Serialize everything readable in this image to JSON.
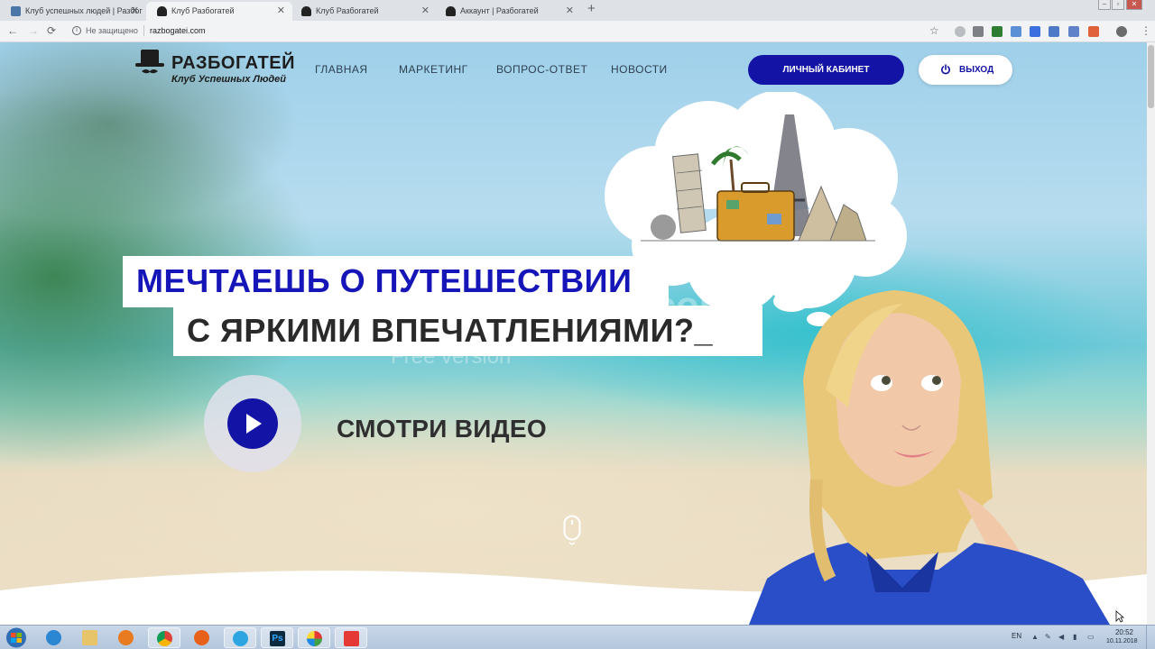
{
  "browser": {
    "tabs": [
      {
        "title": "Клуб успешных людей | Разбог",
        "active": false,
        "favicon_color": "#4a76a8"
      },
      {
        "title": "Клуб Разбогатей",
        "active": true,
        "favicon_color": "#222222"
      },
      {
        "title": "Клуб Разбогатей",
        "active": false,
        "favicon_color": "#222222"
      },
      {
        "title": "Аккаунт | Разбогатей",
        "active": false,
        "favicon_color": "#222222"
      }
    ],
    "new_tab": "+",
    "nav": {
      "back": "←",
      "forward": "→",
      "reload": "⟳"
    },
    "security_label": "Не защищено",
    "url": "razbogatei.com",
    "bookmark": "☆",
    "menu": "⋮"
  },
  "site": {
    "logo": {
      "title": "РАЗБОГАТЕЙ",
      "subtitle": "Клуб Успешных Людей"
    },
    "nav": {
      "home": "ГЛАВНАЯ",
      "marketing": "МАРКЕТИНГ",
      "faq": "ВОПРОС-ОТВЕТ",
      "news": "НОВОСТИ"
    },
    "cabinet_button": "ЛИЧНЫЙ КАБИНЕТ",
    "exit_button": "ВЫХОД",
    "headline_line1": "МЕЧТАЕШЬ О ПУТЕШЕСТВИИ",
    "headline_line2": "С ЯРКИМИ ВПЕЧАТЛЕНИЯМИ?_",
    "watch_video": "СМОТРИ ВИДЕО",
    "colors": {
      "accent": "#1313a6",
      "headline": "#1616b8"
    }
  },
  "watermark": {
    "line1": "DVDVideoSoft.com",
    "line2": "Free version"
  },
  "taskbar": {
    "apps": [
      "ie",
      "explorer",
      "media-player",
      "chrome",
      "firefox",
      "telegram",
      "photoshop",
      "aperture",
      "screen-recorder"
    ],
    "photoshop_label": "Ps",
    "language": "EN",
    "time": "20:52",
    "date": "10.11.2018"
  }
}
